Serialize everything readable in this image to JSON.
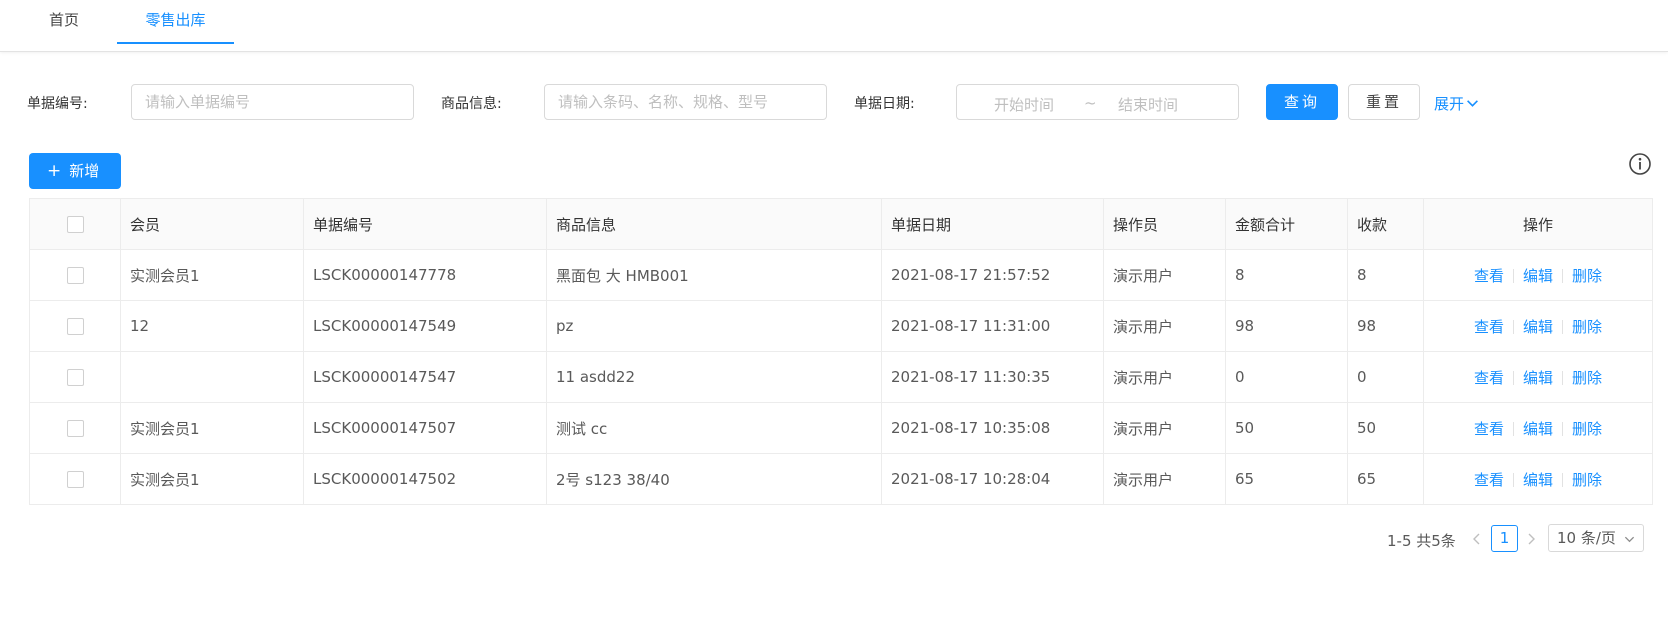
{
  "tabs": [
    {
      "label": "首页"
    },
    {
      "label": "零售出库"
    }
  ],
  "search": {
    "bill_no_label": "单据编号:",
    "bill_no_placeholder": "请输入单据编号",
    "goods_label": "商品信息:",
    "goods_placeholder": "请输入条码、名称、规格、型号",
    "date_label": "单据日期:",
    "start_placeholder": "开始时间",
    "range_sep": "~",
    "end_placeholder": "结束时间",
    "query_label": "查询",
    "reset_label": "重置",
    "expand_label": "展开"
  },
  "toolbar": {
    "add_icon": "+",
    "add_label": "新增"
  },
  "table": {
    "columns": [
      "会员",
      "单据编号",
      "商品信息",
      "单据日期",
      "操作员",
      "金额合计",
      "收款",
      "操作"
    ],
    "rows": [
      {
        "member": "实测会员1",
        "bill_no": "LSCK00000147778",
        "goods": "黑面包 大 HMB001",
        "date": "2021-08-17 21:57:52",
        "operator": "演示用户",
        "amount": "8",
        "received": "8"
      },
      {
        "member": "12",
        "bill_no": "LSCK00000147549",
        "goods": "pz",
        "date": "2021-08-17 11:31:00",
        "operator": "演示用户",
        "amount": "98",
        "received": "98"
      },
      {
        "member": "",
        "bill_no": "LSCK00000147547",
        "goods": "11 asdd22",
        "date": "2021-08-17 11:30:35",
        "operator": "演示用户",
        "amount": "0",
        "received": "0"
      },
      {
        "member": "实测会员1",
        "bill_no": "LSCK00000147507",
        "goods": "测试 cc",
        "date": "2021-08-17 10:35:08",
        "operator": "演示用户",
        "amount": "50",
        "received": "50"
      },
      {
        "member": "实测会员1",
        "bill_no": "LSCK00000147502",
        "goods": "2号 s123 38/40",
        "date": "2021-08-17 10:28:04",
        "operator": "演示用户",
        "amount": "65",
        "received": "65"
      }
    ],
    "actions": {
      "view": "查看",
      "edit": "编辑",
      "delete": "删除"
    }
  },
  "pagination": {
    "total_text": "1-5 共5条",
    "current_page": "1",
    "page_size": "10 条/页"
  },
  "colors": {
    "primary": "#1890ff",
    "border": "#d9d9d9",
    "header_bg": "#fafafa"
  }
}
